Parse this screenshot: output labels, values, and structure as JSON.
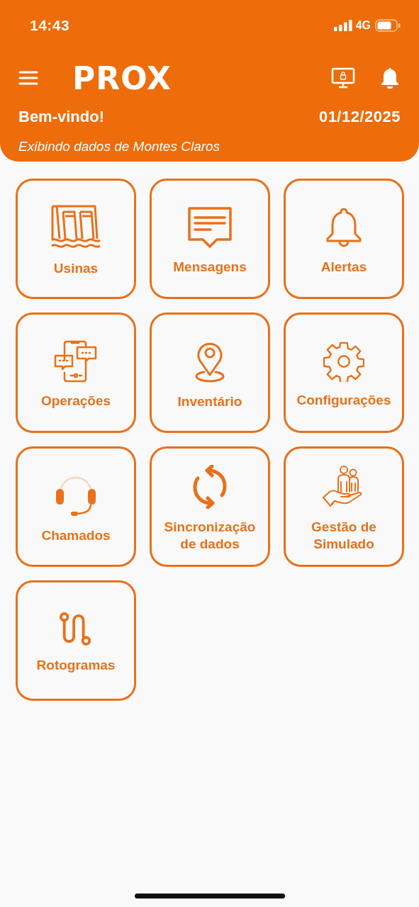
{
  "status_bar": {
    "time": "14:43",
    "network": "4G"
  },
  "header": {
    "logo": "PROX",
    "greeting": "Bem-vindo!",
    "date": "01/12/2025",
    "subtitle": "Exibindo dados de Montes Claros"
  },
  "tiles": [
    {
      "label": "Usinas",
      "kind": "dam"
    },
    {
      "label": "Mensagens",
      "kind": "message"
    },
    {
      "label": "Alertas",
      "kind": "bell"
    },
    {
      "label": "Operações",
      "kind": "chat"
    },
    {
      "label": "Inventário",
      "kind": "pin"
    },
    {
      "label": "Configurações",
      "kind": "gear"
    },
    {
      "label": "Chamados",
      "kind": "headset"
    },
    {
      "label": "Sincronização de dados",
      "kind": "sync"
    },
    {
      "label": "Gestão de Simulado",
      "kind": "people"
    },
    {
      "label": "Rotogramas",
      "kind": "route"
    }
  ]
}
